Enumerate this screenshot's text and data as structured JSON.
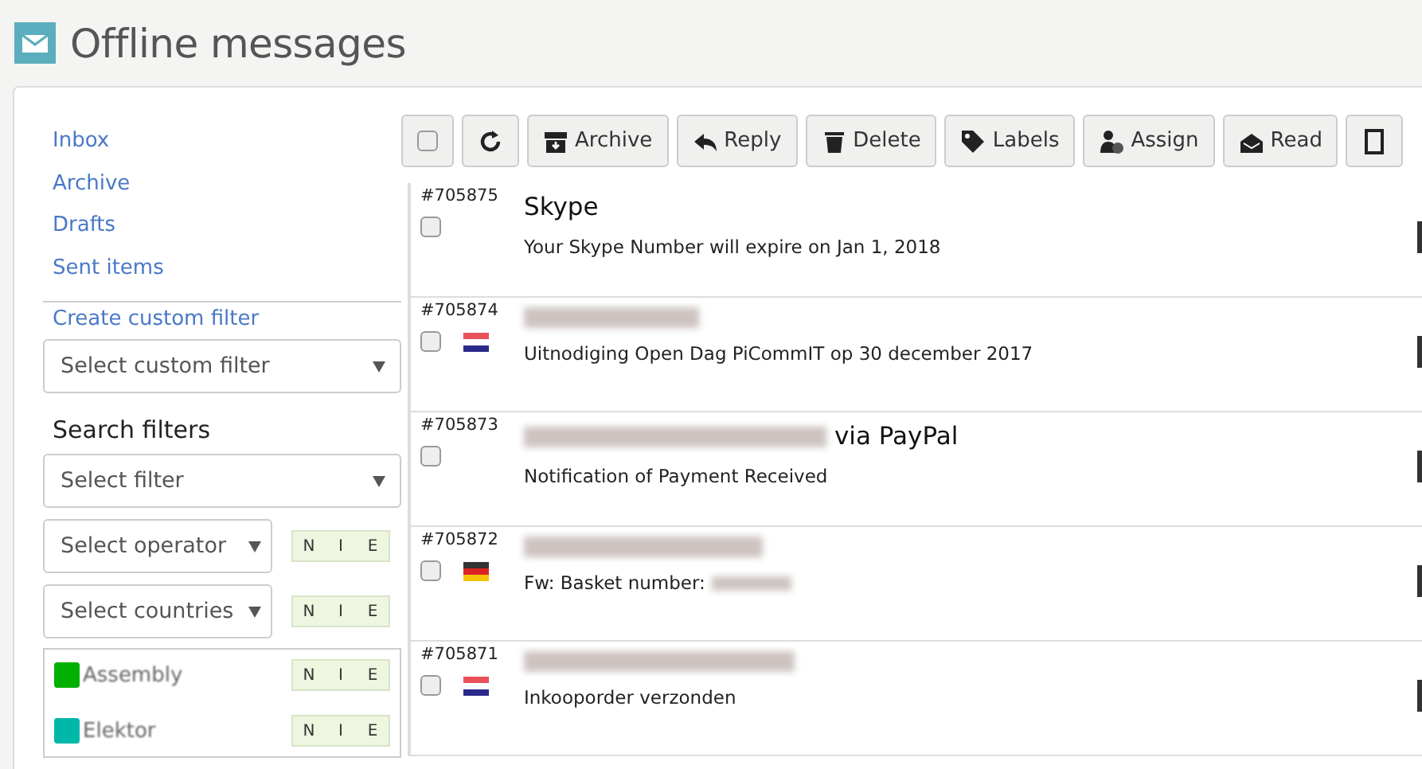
{
  "header": {
    "title": "Offline messages"
  },
  "sidebar": {
    "folders": [
      {
        "label": "Inbox",
        "selected": false
      },
      {
        "label": "Archive",
        "selected": false
      },
      {
        "label": "Drafts",
        "selected": false
      },
      {
        "label": "Sent items",
        "selected": false
      }
    ],
    "create_filter_link": "Create custom filter",
    "custom_filter_select": {
      "placeholder": "Select custom filter"
    },
    "search_filters_heading": "Search filters",
    "filter_select": {
      "placeholder": "Select filter"
    },
    "operator_select": {
      "placeholder": "Select operator",
      "toggle": [
        "N",
        "I",
        "E"
      ]
    },
    "countries_select": {
      "placeholder": "Select countries",
      "toggle": [
        "N",
        "I",
        "E"
      ]
    },
    "labels": [
      {
        "name": "Assembly",
        "color": "#00b000",
        "toggle": [
          "N",
          "I",
          "E"
        ]
      },
      {
        "name": "Elektor",
        "color": "#00b8a8",
        "toggle": [
          "N",
          "I",
          "E"
        ]
      }
    ]
  },
  "toolbar": {
    "select_all": {
      "checked": false
    },
    "buttons": [
      {
        "kind": "refresh"
      },
      {
        "kind": "archive",
        "label": "Archive"
      },
      {
        "kind": "reply",
        "label": "Reply"
      },
      {
        "kind": "delete",
        "label": "Delete"
      },
      {
        "kind": "labels",
        "label": "Labels"
      },
      {
        "kind": "assign",
        "label": "Assign"
      },
      {
        "kind": "read",
        "label": "Read"
      },
      {
        "kind": "more"
      }
    ]
  },
  "messages": [
    {
      "id": "#705875",
      "checked": false,
      "kind": "plain",
      "sender": "Skype",
      "sender_redacted": false,
      "subject": "Your Skype Number will expire on Jan 1, 2018",
      "subject_redacted": false
    },
    {
      "id": "#705874",
      "checked": false,
      "kind": "dutch",
      "sender_redacted": true,
      "subject": "Uitnodiging Open Dag PiCommIT op 30 december 2017",
      "subject_redacted": false
    },
    {
      "id": "#705873",
      "checked": false,
      "kind": "plain",
      "sender": "via PayPal",
      "sender_redacted": true,
      "subject": "Notification of Payment Received",
      "subject_redacted": false
    },
    {
      "id": "#705872",
      "checked": false,
      "kind": "german",
      "sender_redacted": true,
      "subject": "Fw: Basket number:",
      "subject_redacted": true
    },
    {
      "id": "#705871",
      "checked": false,
      "kind": "dutch",
      "sender_redacted": true,
      "subject": "Inkooporder verzonden",
      "subject_redacted": false
    }
  ]
}
